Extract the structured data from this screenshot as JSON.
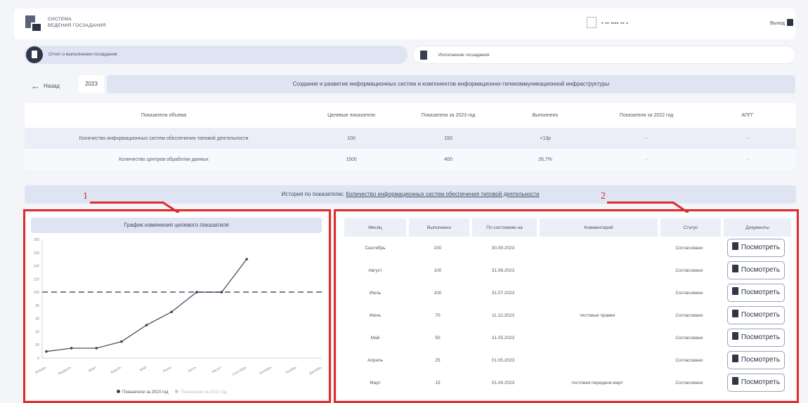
{
  "header": {
    "brand_line1": "СИСТЕМА",
    "brand_line2": "ВЕДЕНИЯ ГОСЗАДАНИЯ",
    "user_name": "▪ ▪▪ ▪▪▪▪ ▪▪ ▪",
    "logout_label": "Выход"
  },
  "tabs": [
    {
      "label": "Отчет о выполнении госзадания"
    },
    {
      "label": "Исполнение госзадания"
    }
  ],
  "nav": {
    "back_label": "Назад",
    "year": "2023",
    "title": "Создание и развитие информационных систем и компонентов информационно-телекоммуникационной инфраструктуры"
  },
  "indicators": {
    "headers": [
      "Показатели объема",
      "Целевые показатели",
      "Показатели за 2023 год",
      "Выполнено",
      "Показатели за 2022 год",
      "АПГГ"
    ],
    "rows": [
      [
        "Количество информационных систем обеспечения типовой деятельности",
        "100",
        "150",
        "+13р",
        "-",
        "-"
      ],
      [
        "Количество центров обработки данных",
        "1500",
        "400",
        "26,7%",
        "-",
        "-"
      ]
    ]
  },
  "history": {
    "prefix": "История по показателю:",
    "link": "Количество информационных систем обеспечения типовой деятельности"
  },
  "callouts": {
    "one": "1",
    "two": "2"
  },
  "chart_data": {
    "type": "line",
    "title": "График изменения целевого показателя",
    "x": [
      "Январь",
      "Февраль",
      "Март",
      "Апрель",
      "Май",
      "Июнь",
      "Июль",
      "Август",
      "Сентябрь",
      "Октябрь",
      "Ноябрь",
      "Декабрь"
    ],
    "series": [
      {
        "name": "Показатели за 2023 год",
        "values": [
          10,
          15,
          15,
          25,
          50,
          70,
          100,
          100,
          150,
          null,
          null,
          null
        ]
      },
      {
        "name": "Показатели за 2022 год",
        "values": []
      }
    ],
    "target": 100,
    "yticks": [
      0,
      20,
      40,
      60,
      80,
      100,
      120,
      140,
      160,
      180
    ],
    "ylim": [
      0,
      180
    ],
    "grid": false,
    "legend": "bottom",
    "colors": {
      "line": "#3a4256",
      "target": "#59607a"
    }
  },
  "history_table": {
    "headers": [
      "Месяц",
      "Выполнено",
      "По состоянию на",
      "Комментарий",
      "Статус",
      "Документы"
    ],
    "rows": [
      [
        "Сентябрь",
        "150",
        "30.09.2023",
        "",
        "Согласовано",
        "Посмотреть"
      ],
      [
        "Август",
        "100",
        "31.08.2023",
        "",
        "Согласовано",
        "Посмотреть"
      ],
      [
        "Июль",
        "100",
        "31.07.2023",
        "",
        "Согласовано",
        "Посмотреть"
      ],
      [
        "Июнь",
        "70",
        "11.12.2023",
        "тестовые правки",
        "Согласовано",
        "Посмотреть"
      ],
      [
        "Май",
        "50",
        "31.05.2023",
        "",
        "Согласовано",
        "Посмотреть"
      ],
      [
        "Апрель",
        "25",
        "01.05.2023",
        "",
        "Согласовано",
        "Посмотреть"
      ],
      [
        "Март",
        "15",
        "01.04.2023",
        "тестовая передача март",
        "Согласовано",
        "Посмотреть"
      ]
    ]
  }
}
